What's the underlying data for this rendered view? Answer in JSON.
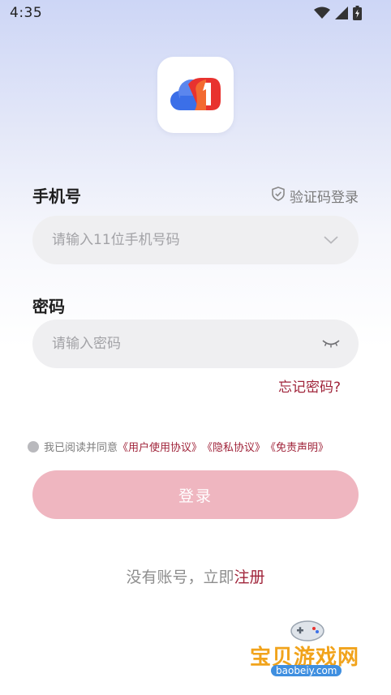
{
  "status_bar": {
    "time": "4:35",
    "icons": [
      "wifi-icon",
      "signal-icon",
      "battery-icon"
    ]
  },
  "app": {
    "logo_icon": "cloud-one-logo",
    "brand_colors": {
      "blue": "#3b6fe8",
      "red": "#e8322f",
      "orange": "#f36a30"
    }
  },
  "phone_section": {
    "label": "手机号",
    "sms_login_label": "验证码登录",
    "sms_login_icon": "shield-check-icon",
    "input_placeholder": "请输入11位手机号码",
    "input_value": "",
    "dropdown_icon": "chevron-down-icon"
  },
  "password_section": {
    "label": "密码",
    "input_placeholder": "请输入密码",
    "input_value": "",
    "visibility_icon": "eye-closed-icon",
    "forgot_label": "忘记密码?"
  },
  "agreement": {
    "prefix": "我已阅读并同意",
    "user_agreement": "《用户使用协议》",
    "privacy_agreement": "《隐私协议》",
    "disclaimer": "《免责声明》",
    "checked": false
  },
  "login_button_label": "登录",
  "register": {
    "prompt": "没有账号，立即",
    "link": "注册"
  },
  "watermark": {
    "title": "宝贝游戏网",
    "url": "baobeiy.com"
  },
  "colors": {
    "accent": "#a0243a",
    "login_button": "#efb6c0",
    "field_background": "#efeff1"
  }
}
